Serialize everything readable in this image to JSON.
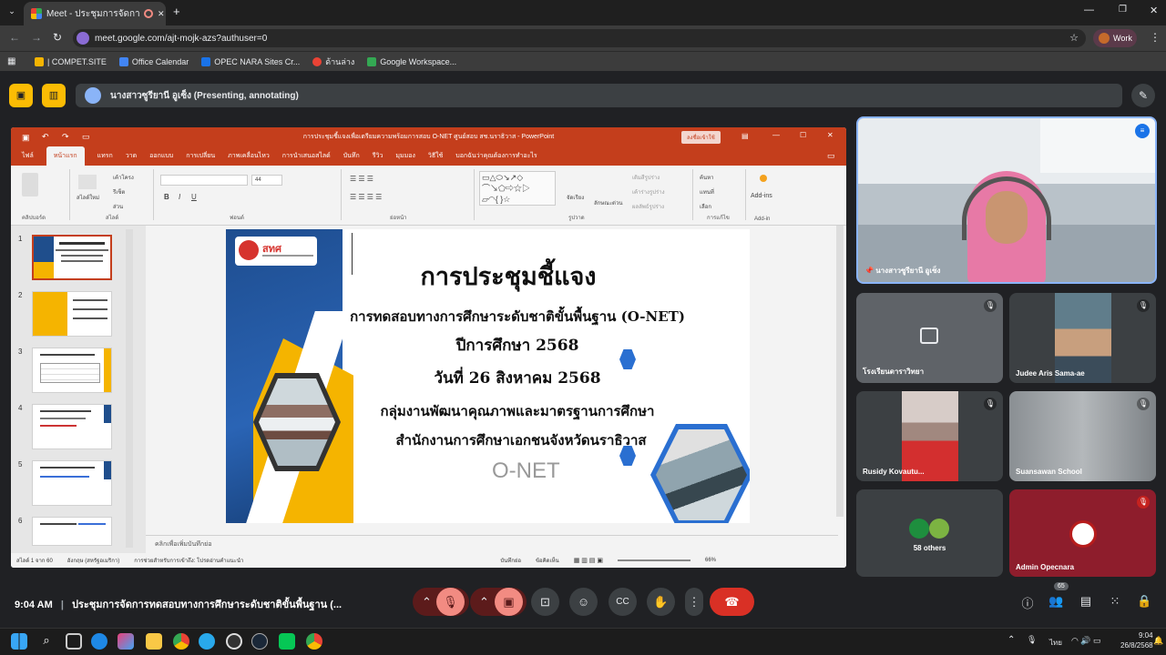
{
  "browser": {
    "tab_title": "Meet - ประชุมการจัดการทดสอบ",
    "url": "meet.google.com/ajt-mojk-azs?authuser=0",
    "profile": "Work",
    "bookmarks": [
      "| COMPET.SITE",
      "Office Calendar",
      "OPEC NARA Sites Cr...",
      "ด้านล่าง",
      "Google Workspace..."
    ]
  },
  "meet": {
    "presenter_bar": "นางสาวซูรียานี อูเซ็ง (Presenting, annotating)",
    "clock": "9:04 AM",
    "meeting_title": "ประชุมการจัดการทดสอบทางการศึกษาระดับชาติขั้นพื้นฐาน (...",
    "participant_count": "65",
    "self_tile_name": "นางสาวซูรียานี อูเซ็ง",
    "tiles": [
      {
        "name": "โรงเรียนดาราวิทยา"
      },
      {
        "name": "Judee Aris Sama-ae"
      },
      {
        "name": "Rusidy Kovautu..."
      },
      {
        "name": "Suansawan School"
      },
      {
        "name": "58 others"
      },
      {
        "name": "Admin Opecnara"
      }
    ]
  },
  "powerpoint": {
    "window_title": "การประชุมชี้แจงเพื่อเตรียมความพร้อมการสอบ O-NET ศูนย์สอบ สช.นราธิวาส - PowerPoint",
    "signin_button": "ลงชื่อเข้าใช้",
    "menu": [
      "ไฟล์",
      "หน้าแรก",
      "แทรก",
      "วาด",
      "ออกแบบ",
      "การเปลี่ยน",
      "ภาพเคลื่อนไหว",
      "การนำเสนอสไลด์",
      "บันทึก",
      "รีวิว",
      "มุมมอง",
      "วิธีใช้",
      "บอกฉันว่าคุณต้องการทำอะไร"
    ],
    "ribbon_groups": [
      "คลิปบอร์ด",
      "สไลด์",
      "ฟอนต์",
      "ย่อหน้า",
      "รูปวาด",
      "การแก้ไข",
      "Add-in"
    ],
    "ribbon_labels": {
      "new_slide": "สไลด์ใหม่",
      "layout": "เค้าโครง",
      "reset": "รีเซ็ต",
      "section": "ส่วน",
      "arrange": "จัดเรียง",
      "quick_styles": "ลักษณะด่วน",
      "fill": "เติมสีรูปร่าง",
      "outline": "เค้าร่างรูปร่าง",
      "effects": "ผลลัพธ์รูปร่าง",
      "find": "ค้นหา",
      "replace": "แทนที่",
      "select": "เลือก",
      "addins": "Add-ins",
      "font_size": "44"
    },
    "thumb_numbers": [
      "1",
      "2",
      "3",
      "4",
      "5",
      "6"
    ],
    "notes_placeholder": "คลิกเพื่อเพิ่มบันทึกย่อ",
    "status": {
      "slide_of": "สไลด์ 1 จาก 60",
      "language": "อังกฤษ (สหรัฐอเมริกา)",
      "accessibility": "การช่วยสำหรับการเข้าถึง: โปรดอ่านคำแนะนำ",
      "notes": "บันทึกย่อ",
      "comments": "ข้อคิดเห็น",
      "zoom": "66%"
    },
    "slide": {
      "title": "การประชุมชี้แจง",
      "line1": "การทดสอบทางการศึกษาระดับชาติขั้นพื้นฐาน (O-NET)",
      "line2": "ปีการศึกษา 2568",
      "line3": "วันที่ 26 สิงหาคม 2568",
      "line4": "กลุ่มงานพัฒนาคุณภาพและมาตรฐานการศึกษา",
      "line5": "สำนักงานการศึกษาเอกชนจังหวัดนราธิวาส",
      "onet": "O-NET",
      "logo_text": "สทศ"
    }
  },
  "taskbar": {
    "time": "9:04",
    "date": "26/8/2568",
    "lang": "ไทย"
  }
}
